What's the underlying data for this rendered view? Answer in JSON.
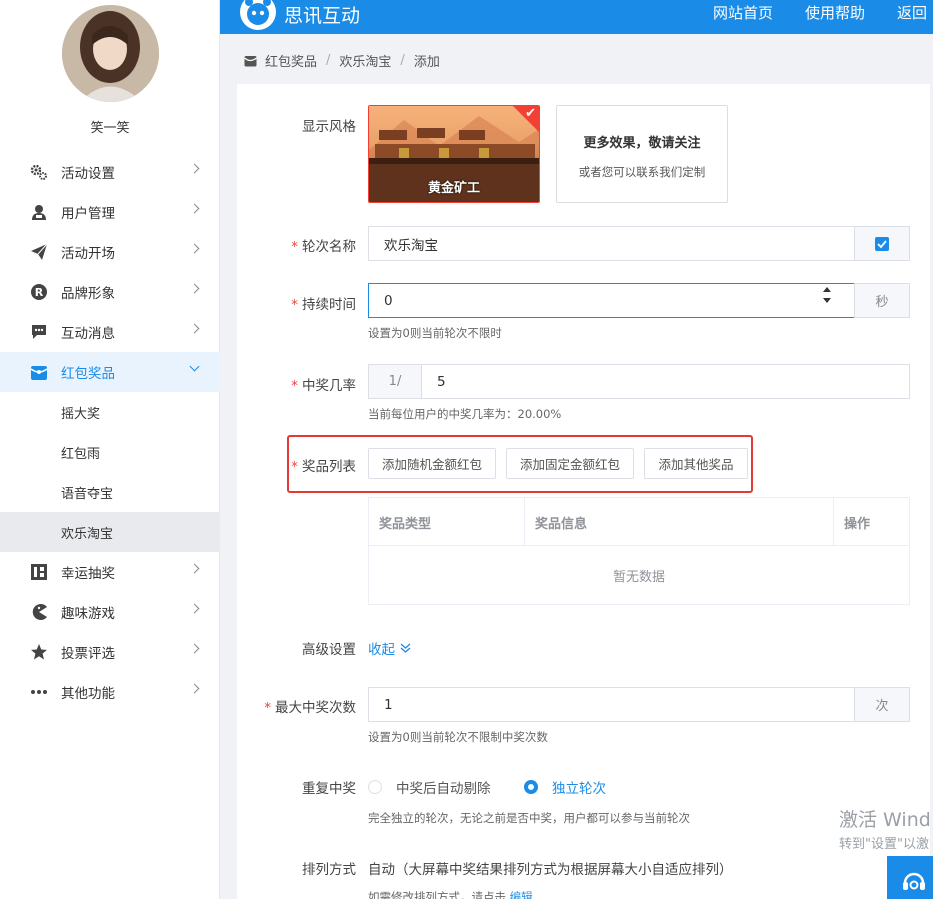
{
  "header": {
    "brand": "思讯互动",
    "links": [
      "网站首页",
      "使用帮助",
      "返回"
    ]
  },
  "user": {
    "name": "笑一笑"
  },
  "sidebar": {
    "items": [
      {
        "label": "活动设置",
        "icon": "gears-icon"
      },
      {
        "label": "用户管理",
        "icon": "user-icon"
      },
      {
        "label": "活动开场",
        "icon": "paper-plane-icon"
      },
      {
        "label": "品牌形象",
        "icon": "registered-icon"
      },
      {
        "label": "互动消息",
        "icon": "chat-icon"
      },
      {
        "label": "红包奖品",
        "icon": "gift-box-icon"
      },
      {
        "label": "幸运抽奖",
        "icon": "lottery-icon"
      },
      {
        "label": "趣味游戏",
        "icon": "pacman-icon"
      },
      {
        "label": "投票评选",
        "icon": "star-icon"
      },
      {
        "label": "其他功能",
        "icon": "more-icon"
      }
    ],
    "submenu": [
      "摇大奖",
      "红包雨",
      "语音夺宝",
      "欢乐淘宝"
    ]
  },
  "breadcrumb": [
    "红包奖品",
    "欢乐淘宝",
    "添加"
  ],
  "form": {
    "style_label": "显示风格",
    "style_selected": "黄金矿工",
    "more_title": "更多效果，敬请关注",
    "more_sub": "或者您可以联系我们定制",
    "round_name_label": "轮次名称",
    "round_name_value": "欢乐淘宝",
    "duration_label": "持续时间",
    "duration_value": "0",
    "duration_unit": "秒",
    "duration_hint": "设置为0则当前轮次不限时",
    "rate_label": "中奖几率",
    "rate_prefix": "1/",
    "rate_value": "5",
    "rate_hint": "当前每位用户的中奖几率为：20.00%",
    "prize_list_label": "奖品列表",
    "btn_random": "添加随机金额红包",
    "btn_fixed": "添加固定金额红包",
    "btn_other": "添加其他奖品",
    "table_headers": [
      "奖品类型",
      "奖品信息",
      "操作"
    ],
    "table_empty": "暂无数据",
    "advanced_label": "高级设置",
    "advanced_toggle": "收起",
    "max_win_label": "最大中奖次数",
    "max_win_value": "1",
    "max_win_unit": "次",
    "max_win_hint": "设置为0则当前轮次不限制中奖次数",
    "repeat_label": "重复中奖",
    "repeat_opt1": "中奖后自动剔除",
    "repeat_opt2": "独立轮次",
    "repeat_hint": "完全独立的轮次，无论之前是否中奖，用户都可以参与当前轮次",
    "sort_label": "排列方式",
    "sort_value": "自动（大屏幕中奖结果排列方式为根据屏幕大小自适应排列）",
    "sort_hint": "如需修改排列方式，请点击",
    "sort_edit": "编辑"
  },
  "watermark": {
    "line1": "激活 Wind",
    "line2": "转到\"设置\"以激"
  },
  "colors": {
    "primary": "#1a8ce8",
    "danger": "#f04134"
  }
}
